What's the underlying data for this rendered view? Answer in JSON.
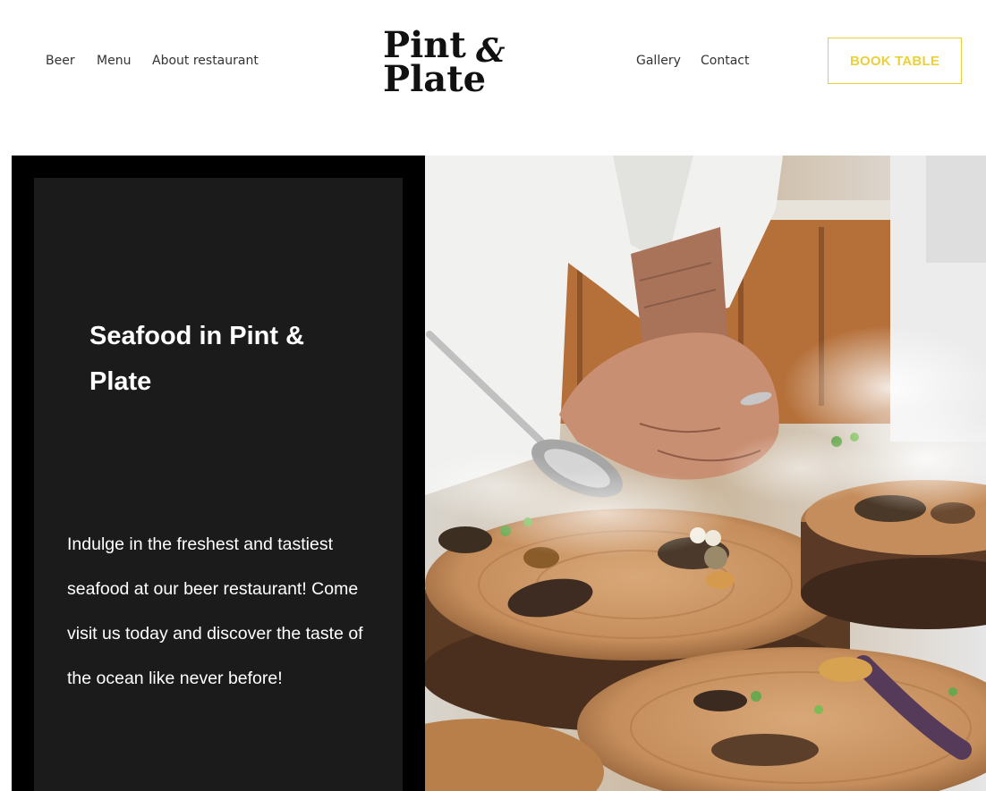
{
  "header": {
    "nav_left": [
      "Beer",
      "Menu",
      "About restaurant"
    ],
    "nav_right": [
      "Gallery",
      "Contact"
    ],
    "logo": {
      "line1": "Pint",
      "ampersand": "&",
      "line2": "Plate"
    },
    "book_button": "BOOK TABLE"
  },
  "hero": {
    "title": "Seafood in Pint & Plate",
    "text": "Indulge in the freshest and tastiest seafood at our beer restaurant! Come visit us today and discover the taste of the ocean like never before!"
  },
  "colors": {
    "accent": "#ead03a",
    "panel": "#1b1b1b",
    "frame": "#000000",
    "text_dark": "#333333"
  },
  "icons": {
    "photo": "chef-plating-food-photo"
  }
}
